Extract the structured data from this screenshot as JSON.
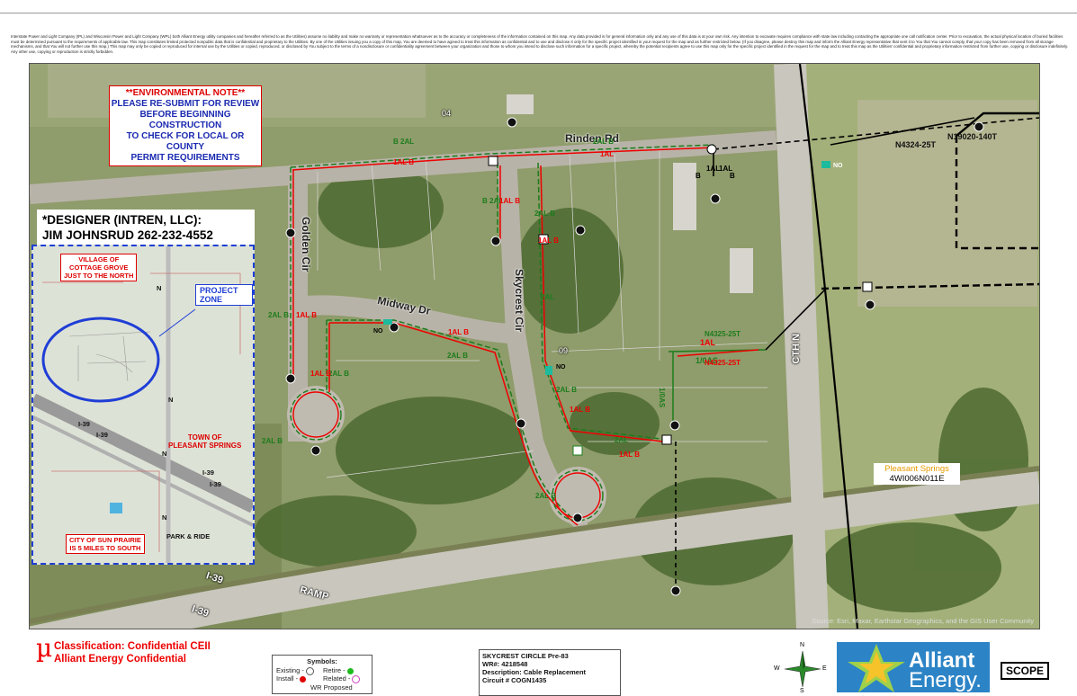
{
  "disclaimer": "Interstate Power and Light Company (IPL) and Wisconsin Power and Light Company (WPL) both Alliant Energy utility companies and hereafter referred to as the Utilities) assume no liability and make no warranty or representation whatsoever as to the accuracy or completeness of the information contained on this map. Any data provided is for general information only and any use of this data is at your own risk. Any intention to excavate requires compliance with state law including contacting the appropriate one call notification center. Prior to excavation, the actual physical location of buried facilities must be determined pursuant to the requirements of applicable law. This map constitutes limited protected nonpublic data that is confidential and proprietary to the Utilities. By one of the Utilities issuing you a copy of this map, You are deemed to have agreed to treat this information as confidential and to use and disclose it only for the specific project identified in your request for the map and as further restricted below. (If you disagree, please destroy this map and inform the Alliant Energy representative that sent it to You that You cannot comply, that your copy has been removed from all storage mechanisms, and that You will not further use this map.) This map may only be copied or reproduced for internal use by the Utilities or copied, reproduced, or disclosed by You subject to the terms of a nondisclosure or confidentiality agreement between your organization and those to whom you intend to disclose such information for a specific project, whereby the potential recipients agree to use this map only for the specific project identified in the request for the map and to treat this map as the Utilities' confidential and proprietary information restricted from further use, copying or disclosure indefinitely. Any other use, copying or reproduction is strictly forbidden.",
  "env_note": {
    "title": "**ENVIRONMENTAL NOTE**",
    "lines": [
      "PLEASE RE-SUBMIT FOR REVIEW",
      "BEFORE BEGINNING CONSTRUCTION",
      "TO CHECK FOR LOCAL OR COUNTY",
      "PERMIT REQUIREMENTS"
    ]
  },
  "designer": {
    "line1": "*DESIGNER (INTREN, LLC):",
    "line2": "JIM JOHNSRUD 262-232-4552"
  },
  "inset": {
    "village_note": [
      "VILLAGE OF",
      "COTTAGE GROVE",
      "JUST TO THE NORTH"
    ],
    "project_zone": "PROJECT ZONE",
    "town_note": [
      "TOWN OF",
      "PLEASANT SPRINGS"
    ],
    "city_note": [
      "CITY OF SUN PRAIRIE",
      "IS 5 MILES TO SOUTH"
    ],
    "park_ride": "PARK & RIDE",
    "i39_a": "I-39",
    "i39_b": "I-39",
    "i39_c": "I-39",
    "i39_d": "I-39",
    "n_labels": [
      "N",
      "N",
      "N",
      "N"
    ]
  },
  "roads": {
    "rinden": "Rinden Rd",
    "golden": "Golden Cir",
    "midway": "Midway Dr",
    "skycrest": "Skycrest Cir",
    "cth": "CTH N",
    "i39_a": "I-39",
    "i39_b": "I-39",
    "ramp": "RAMP"
  },
  "cable_labels": {
    "green": [
      "B 2AL",
      "2AL B",
      "B 2AL",
      "2AL B",
      "2AL B",
      "2AL",
      "2AL B",
      "2AL B",
      "2AL B",
      "2AL B",
      "2AL",
      "1/0AS",
      "1/0AS",
      "2AL B"
    ],
    "red": [
      "1AL B",
      "1AL B",
      "1AL B",
      "1AL B",
      "1AL B",
      "1AL",
      "1AL B",
      "1AL",
      "1AL B",
      "1AL B"
    ],
    "black": [
      "B",
      "1AL",
      "1AL",
      "B"
    ],
    "no": [
      "NO",
      "NO",
      "NO"
    ]
  },
  "circuits": {
    "n4324": "N4324-25T",
    "n19020": "N19020-140T",
    "n4325a": "N4325-25T",
    "n4325b": "N4325-25T"
  },
  "section_04": "04",
  "section_09": "09",
  "pleasant_springs": {
    "name": "Pleasant Springs",
    "code": "4WI006N011E"
  },
  "attribution": "Source: Esri, Maxar, Earthstar Geographics, and the GIS User Community",
  "classification": {
    "line1": "Classification: Confidential CEII",
    "line2": "Alliant Energy Confidential",
    "symbol": "µ"
  },
  "symbols": {
    "title": "Symbols:",
    "existing": "Existing -",
    "install": "Install -",
    "retire": "Retire -",
    "related": "Related -",
    "wr_proposed": "WR Proposed"
  },
  "project_info": {
    "line1": "SKYCREST CIRCLE Pre-83",
    "line2": "WR#: 4218548",
    "line3": "Description: Cable Replacement",
    "line4": "Circuit # COGN1435"
  },
  "compass": {
    "n": "N",
    "s": "S",
    "e": "E",
    "w": "W"
  },
  "logo": {
    "line1": "Alliant",
    "line2": "Energy."
  },
  "scope": "SCOPE",
  "colors": {
    "install": "#e00000",
    "retire": "#1dbb1d",
    "related": "#d040c0",
    "inset_border": "#1f3ed6",
    "logo_bg": "#2c84c6"
  }
}
